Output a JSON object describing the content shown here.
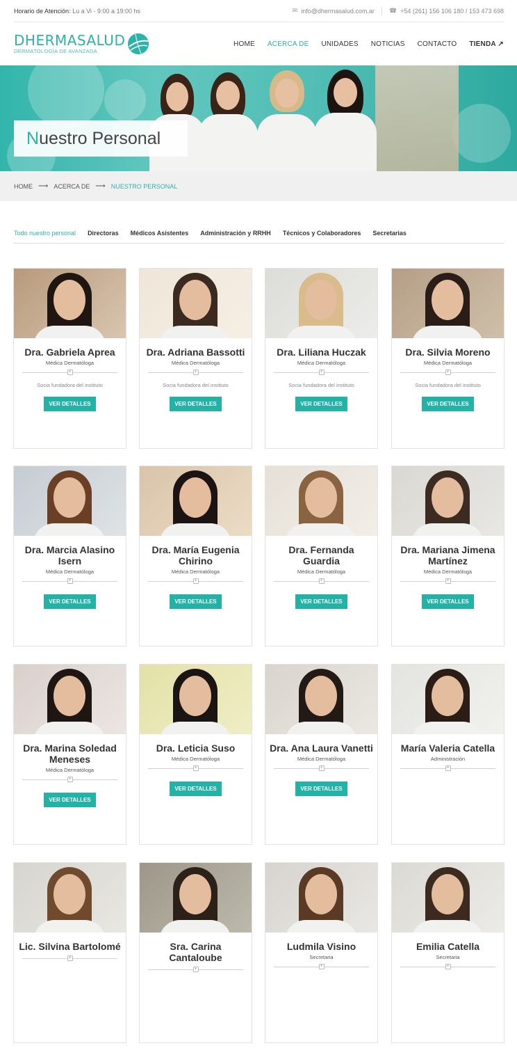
{
  "topbar": {
    "hours_label": "Horario de Atención:",
    "hours_value": "Lu a Vi - 9:00 a 19:00 hs",
    "email": "info@dhermasalud.com.ar",
    "phone": "+54 (261) 156 106 180 / 153 473 698"
  },
  "logo": {
    "main": "DHERMASALUD",
    "sub": "DERMATOLOGÍA DE AVANZADA"
  },
  "nav": [
    {
      "label": "HOME"
    },
    {
      "label": "ACERCA DE"
    },
    {
      "label": "UNIDADES"
    },
    {
      "label": "NOTICIAS"
    },
    {
      "label": "CONTACTO"
    },
    {
      "label": "TIENDA"
    }
  ],
  "hero": {
    "title_first": "N",
    "title_rest": "uestro Personal"
  },
  "breadcrumb": {
    "home": "HOME",
    "parent": "ACERCA DE",
    "current": "NUESTRO PERSONAL"
  },
  "filters": [
    {
      "label": "Todo nuestro personal"
    },
    {
      "label": "Directoras"
    },
    {
      "label": "Médicos Asistentes"
    },
    {
      "label": "Administración y RRHH"
    },
    {
      "label": "Técnicos y Colaboradores"
    },
    {
      "label": "Secretarias"
    }
  ],
  "button_label": "VER DETALLES",
  "staff": [
    {
      "name": "Dra. Gabriela Aprea",
      "role": "Médica Dermatóloga",
      "note": "Socia fundadora del instituto",
      "button": true
    },
    {
      "name": "Dra. Adriana Bassotti",
      "role": "Médica Dermatóloga",
      "note": "Socia fundadora del instituto",
      "button": true
    },
    {
      "name": "Dra. Liliana Huczak",
      "role": "Médica Dermatóloga",
      "note": "Socia fundadora del instituto",
      "button": true
    },
    {
      "name": "Dra. Silvia Moreno",
      "role": "Médica Dermatóloga",
      "note": "Socia fundadora del instituto",
      "button": true
    },
    {
      "name": "Dra. Marcia Alasino Isern",
      "role": "Médica Dermatóloga",
      "note": "",
      "button": true
    },
    {
      "name": "Dra. María Eugenia Chirino",
      "role": "Médica Dermatóloga",
      "note": "",
      "button": true
    },
    {
      "name": "Dra. Fernanda Guardia",
      "role": "Médica Dermatóloga",
      "note": "",
      "button": true
    },
    {
      "name": "Dra. Mariana Jimena Martínez",
      "role": "Médica Dermatóloga",
      "note": "",
      "button": true
    },
    {
      "name": "Dra. Marina Soledad Meneses",
      "role": "Médica Dermatóloga",
      "note": "",
      "button": true
    },
    {
      "name": "Dra. Leticia Suso",
      "role": "Médica Dermatóloga",
      "note": "",
      "button": true
    },
    {
      "name": "Dra. Ana Laura Vanetti",
      "role": "Médica Dermatóloga",
      "note": "",
      "button": true
    },
    {
      "name": "María Valeria Catella",
      "role": "Administración",
      "note": "",
      "button": false
    },
    {
      "name": "Lic. Silvina Bartolomé",
      "role": "",
      "note": "",
      "button": false
    },
    {
      "name": "Sra. Carina Cantaloube",
      "role": "",
      "note": "",
      "button": false
    },
    {
      "name": "Ludmila Visino",
      "role": "Secretaria",
      "note": "",
      "button": false
    },
    {
      "name": "Emilia Catella",
      "role": "Secretaria",
      "note": "",
      "button": false
    }
  ],
  "colors": {
    "accent": "#23b3a6",
    "text": "#333333",
    "breadcrumb_bg": "#f0f0f0"
  }
}
